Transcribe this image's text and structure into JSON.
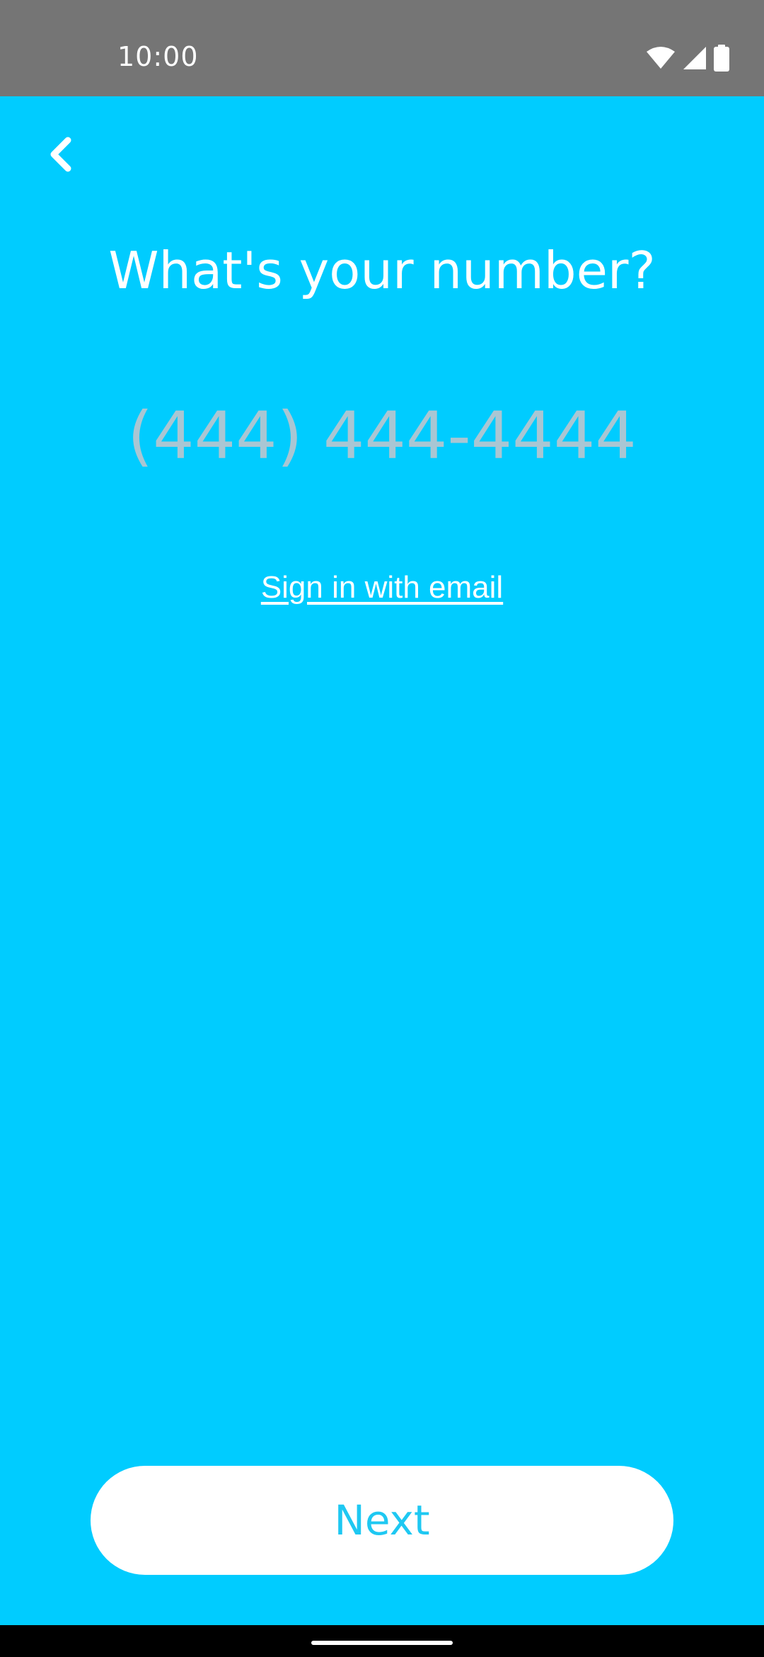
{
  "status_bar": {
    "time": "10:00",
    "icons": [
      "wifi-icon",
      "signal-icon",
      "battery-icon"
    ]
  },
  "header": {
    "back_icon": "chevron-left-icon"
  },
  "main": {
    "title": "What's your number?",
    "phone_input": {
      "placeholder": "(444) 444-4444",
      "value": ""
    },
    "email_link": "Sign in with email"
  },
  "footer": {
    "next_label": "Next"
  },
  "colors": {
    "background": "#00CCFF",
    "status_bar": "#757575",
    "button_background": "#FFFFFF",
    "button_text": "#1EC8F2",
    "placeholder": "#A9C6D3"
  }
}
